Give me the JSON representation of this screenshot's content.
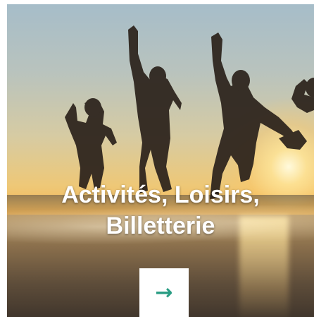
{
  "card": {
    "image": "silhouettes-jumping-sunset-lake",
    "title_line1": "Activités, Loisirs,",
    "title_line2": "Billetterie",
    "arrow_icon": "arrow-right-icon",
    "arrow_glyph": "→",
    "arrow_color": "#2a9d84"
  }
}
